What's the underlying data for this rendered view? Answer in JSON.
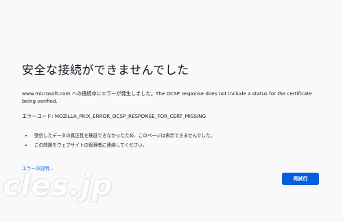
{
  "error": {
    "title": "安全な接続ができませんでした",
    "description": "www.microsoft.com への接続中にエラーが発生しました。The OCSP response does not include a status for the certificate being verified.",
    "code_line": "エラーコード: MOZILLA_PKIX_ERROR_OCSP_RESPONSE_FOR_CERT_MISSING",
    "suggestions": [
      "受信したデータの真正性を検証できなかったため、このページは表示できませんでした。",
      "この問題をウェブサイトの管理者に連絡してください。"
    ],
    "learn_more_label": "エラーの説明...",
    "retry_label": "再試行"
  },
  "watermark": {
    "text": "cles.jp"
  },
  "colors": {
    "background": "#f9f9fb",
    "accent": "#0061e0",
    "text": "#15141a"
  }
}
